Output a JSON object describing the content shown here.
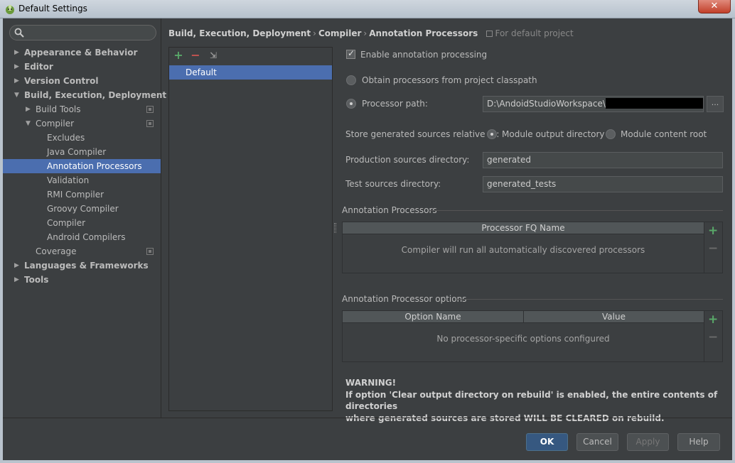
{
  "window": {
    "title": "Default Settings",
    "close_label": "✕"
  },
  "search": {
    "placeholder": "",
    "value": ""
  },
  "sidebar": {
    "items": [
      {
        "label": "Appearance & Behavior",
        "level": 0,
        "arrow": "▶",
        "bold": true
      },
      {
        "label": "Editor",
        "level": 0,
        "arrow": "▶",
        "bold": true
      },
      {
        "label": "Version Control",
        "level": 0,
        "arrow": "▶",
        "bold": true
      },
      {
        "label": "Build, Execution, Deployment",
        "level": 0,
        "arrow": "▼",
        "bold": true
      },
      {
        "label": "Build Tools",
        "level": 1,
        "arrow": "▶",
        "copy": true
      },
      {
        "label": "Compiler",
        "level": 1,
        "arrow": "▼",
        "copy": true
      },
      {
        "label": "Excludes",
        "level": 2
      },
      {
        "label": "Java Compiler",
        "level": 2
      },
      {
        "label": "Annotation Processors",
        "level": 2,
        "selected": true
      },
      {
        "label": "Validation",
        "level": 2
      },
      {
        "label": "RMI Compiler",
        "level": 2
      },
      {
        "label": "Groovy Compiler",
        "level": 2
      },
      {
        "label": "Compiler",
        "level": 2
      },
      {
        "label": "Android Compilers",
        "level": 2
      },
      {
        "label": "Coverage",
        "level": 1,
        "copy": true
      },
      {
        "label": "Languages & Frameworks",
        "level": 0,
        "arrow": "▶",
        "bold": true
      },
      {
        "label": "Tools",
        "level": 0,
        "arrow": "▶",
        "bold": true
      }
    ]
  },
  "breadcrumb": {
    "parts": [
      "Build, Execution, Deployment",
      "Compiler",
      "Annotation Processors"
    ],
    "separator": "›",
    "scope": "For default project"
  },
  "profiles": {
    "add": "+",
    "remove": "−",
    "export": "⇲",
    "items": [
      "Default"
    ]
  },
  "settings": {
    "enable_label": "Enable annotation processing",
    "enable_checked": true,
    "obtain_label": "Obtain processors from project classpath",
    "processor_path_label": "Processor path:",
    "processor_path_value": "D:\\AndoidStudioWorkspace\\",
    "browse_label": "...",
    "store_label": "Store generated sources relative to:",
    "module_output_label": "Module output directory",
    "module_content_label": "Module content root",
    "production_label": "Production sources directory:",
    "production_value": "generated",
    "test_label": "Test sources directory:",
    "test_value": "generated_tests"
  },
  "processors_section": {
    "title": "Annotation Processors",
    "column": "Processor FQ Name",
    "empty": "Compiler will run all automatically discovered processors"
  },
  "options_section": {
    "title": "Annotation Processor options",
    "columns": [
      "Option Name",
      "Value"
    ],
    "empty": "No processor-specific options configured"
  },
  "warning": {
    "title": "WARNING!",
    "line1": "If option 'Clear output directory on rebuild' is enabled, the entire contents of directories",
    "line2": "where generated sources are stored WILL BE CLEARED on rebuild."
  },
  "buttons": {
    "ok": "OK",
    "cancel": "Cancel",
    "apply": "Apply",
    "help": "Help"
  },
  "colors": {
    "background": "#3c3f41",
    "selection": "#4b6eaf",
    "add": "#59a869",
    "remove": "#c75450",
    "primary_button": "#365880"
  }
}
